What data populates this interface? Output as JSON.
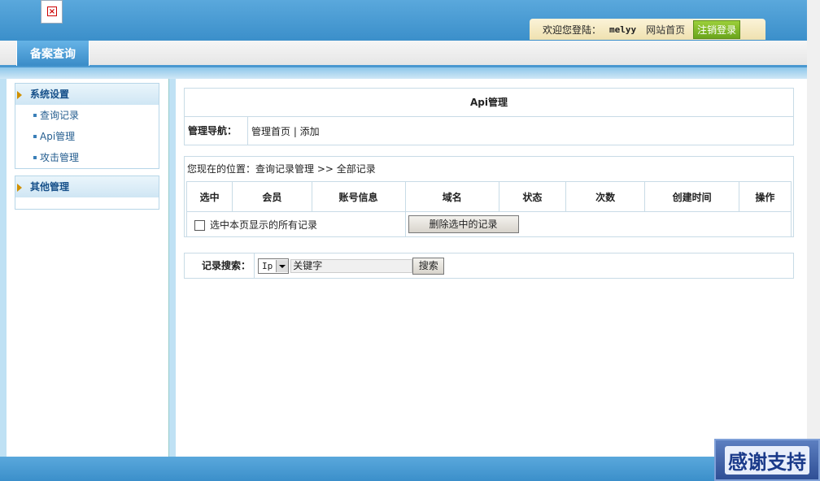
{
  "header": {
    "welcome_label": "欢迎您登陆：",
    "username": "melyy",
    "site_home": "网站首页",
    "logout": "注销登录"
  },
  "tabs": [
    {
      "label": "备案查询",
      "active": true
    }
  ],
  "sidebar": {
    "groups": [
      {
        "title": "系统设置",
        "items": [
          "查询记录",
          "Api管理",
          "攻击管理"
        ]
      },
      {
        "title": "其他管理",
        "items": []
      }
    ]
  },
  "main": {
    "panel_title": "Api管理",
    "nav_label": "管理导航：",
    "nav_links": "管理首页 | 添加",
    "location": "您现在的位置：查询记录管理 >> 全部记录",
    "table": {
      "columns": [
        "选中",
        "会员",
        "账号信息",
        "域名",
        "状态",
        "次数",
        "创建时间",
        "操作"
      ],
      "select_all_label": "选中本页显示的所有记录",
      "delete_button": "删除选中的记录"
    },
    "search": {
      "label": "记录搜索：",
      "field_selected": "Ip",
      "keyword_value": "关键字",
      "button": "搜索"
    }
  },
  "badge": {
    "text": "感谢支持"
  },
  "colors": {
    "header_blue": "#3b8fca",
    "side_title": "#16508a",
    "logout_green": "#6aa51c"
  }
}
